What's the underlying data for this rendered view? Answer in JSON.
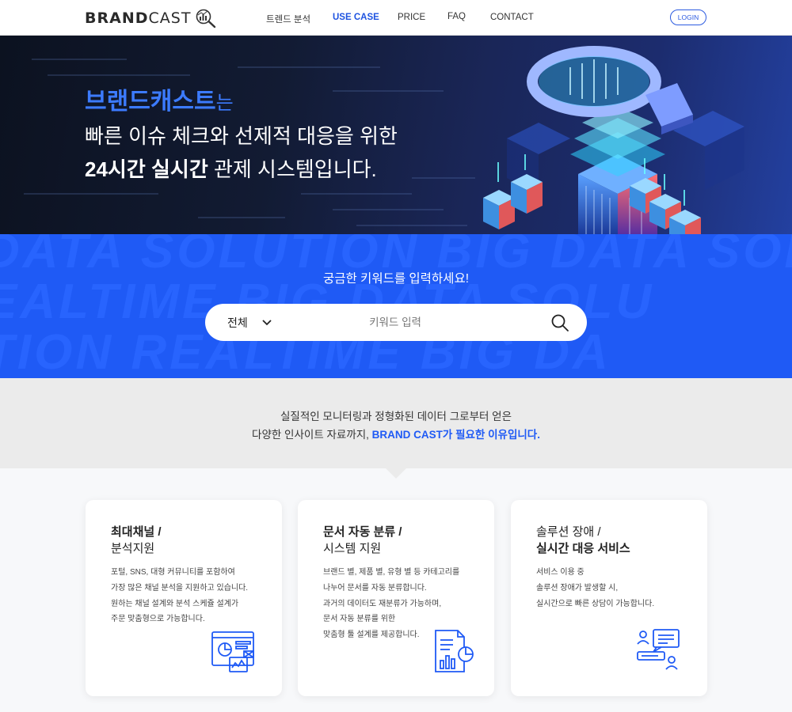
{
  "nav": {
    "logo_bold": "BRAND",
    "logo_light": "CAST",
    "items": [
      {
        "label": "트렌드 분석",
        "active": false
      },
      {
        "label": "USE CASE",
        "active": true
      },
      {
        "label": "PRICE",
        "active": false
      },
      {
        "label": "FAQ",
        "active": false
      },
      {
        "label": "CONTACT",
        "active": false
      }
    ],
    "login_label": "LOGIN"
  },
  "hero": {
    "line1_brand": "브랜드캐스트",
    "line1_suffix": "는",
    "line2": "빠른 이슈 체크와 선제적 대응을 위한",
    "line3_bold": "24시간 실시간",
    "line3_rest": " 관제 시스템입니다."
  },
  "search": {
    "bg_words": [
      "DATA SOLUTION BIG DATA SOLU",
      "EALTIME BIG DATA SOLU",
      "TION REALTIME BIG DA"
    ],
    "title": "궁금한 키워드를 입력하세요!",
    "category_selected": "전체",
    "placeholder": "키워드 입력"
  },
  "intro": {
    "line1": "실질적인 모니터링과 정형화된 데이터 그로부터 얻은",
    "line2_prefix": "다양한 인사이트 자료까지, ",
    "line2_highlight": "BRAND CAST가 필요한 이유입니다."
  },
  "cards": [
    {
      "title_line1": "최대채널 /",
      "title_line2": "분석지원",
      "desc": [
        "포털, SNS, 대형 커뮤니티를 포함하여",
        "가장 많은 채널 분석을 지원하고 있습니다.",
        "원하는 채널 설계와 분석 스케쥴 설계가",
        "주문 맞춤형으로 가능합니다."
      ],
      "icon": "dashboard-analytics-icon"
    },
    {
      "title_line1": "문서 자동 분류 /",
      "title_line2": "시스템 지원",
      "desc": [
        "브랜드 별, 제품 별, 유형 별 등 카테고리를",
        "나누어 문서를 자동 분류합니다.",
        "과거의 데이터도 재분류가 가능하며,",
        "문서 자동 분류를 위한",
        "맞춤형 툴 설계를 제공합니다."
      ],
      "icon": "document-report-icon"
    },
    {
      "title_line1": "솔루션 장애 /",
      "title_line2": "실시간 대응 서비스",
      "desc": [
        "서비스 이용 중",
        "솔루션 장애가 발생할 시,",
        "실시간으로 빠른 상담이 가능합니다."
      ],
      "icon": "chat-support-icon"
    }
  ],
  "colors": {
    "accent": "#1f5af5",
    "nav_active": "#1e53e0",
    "intro_bg": "#ebebeb"
  }
}
